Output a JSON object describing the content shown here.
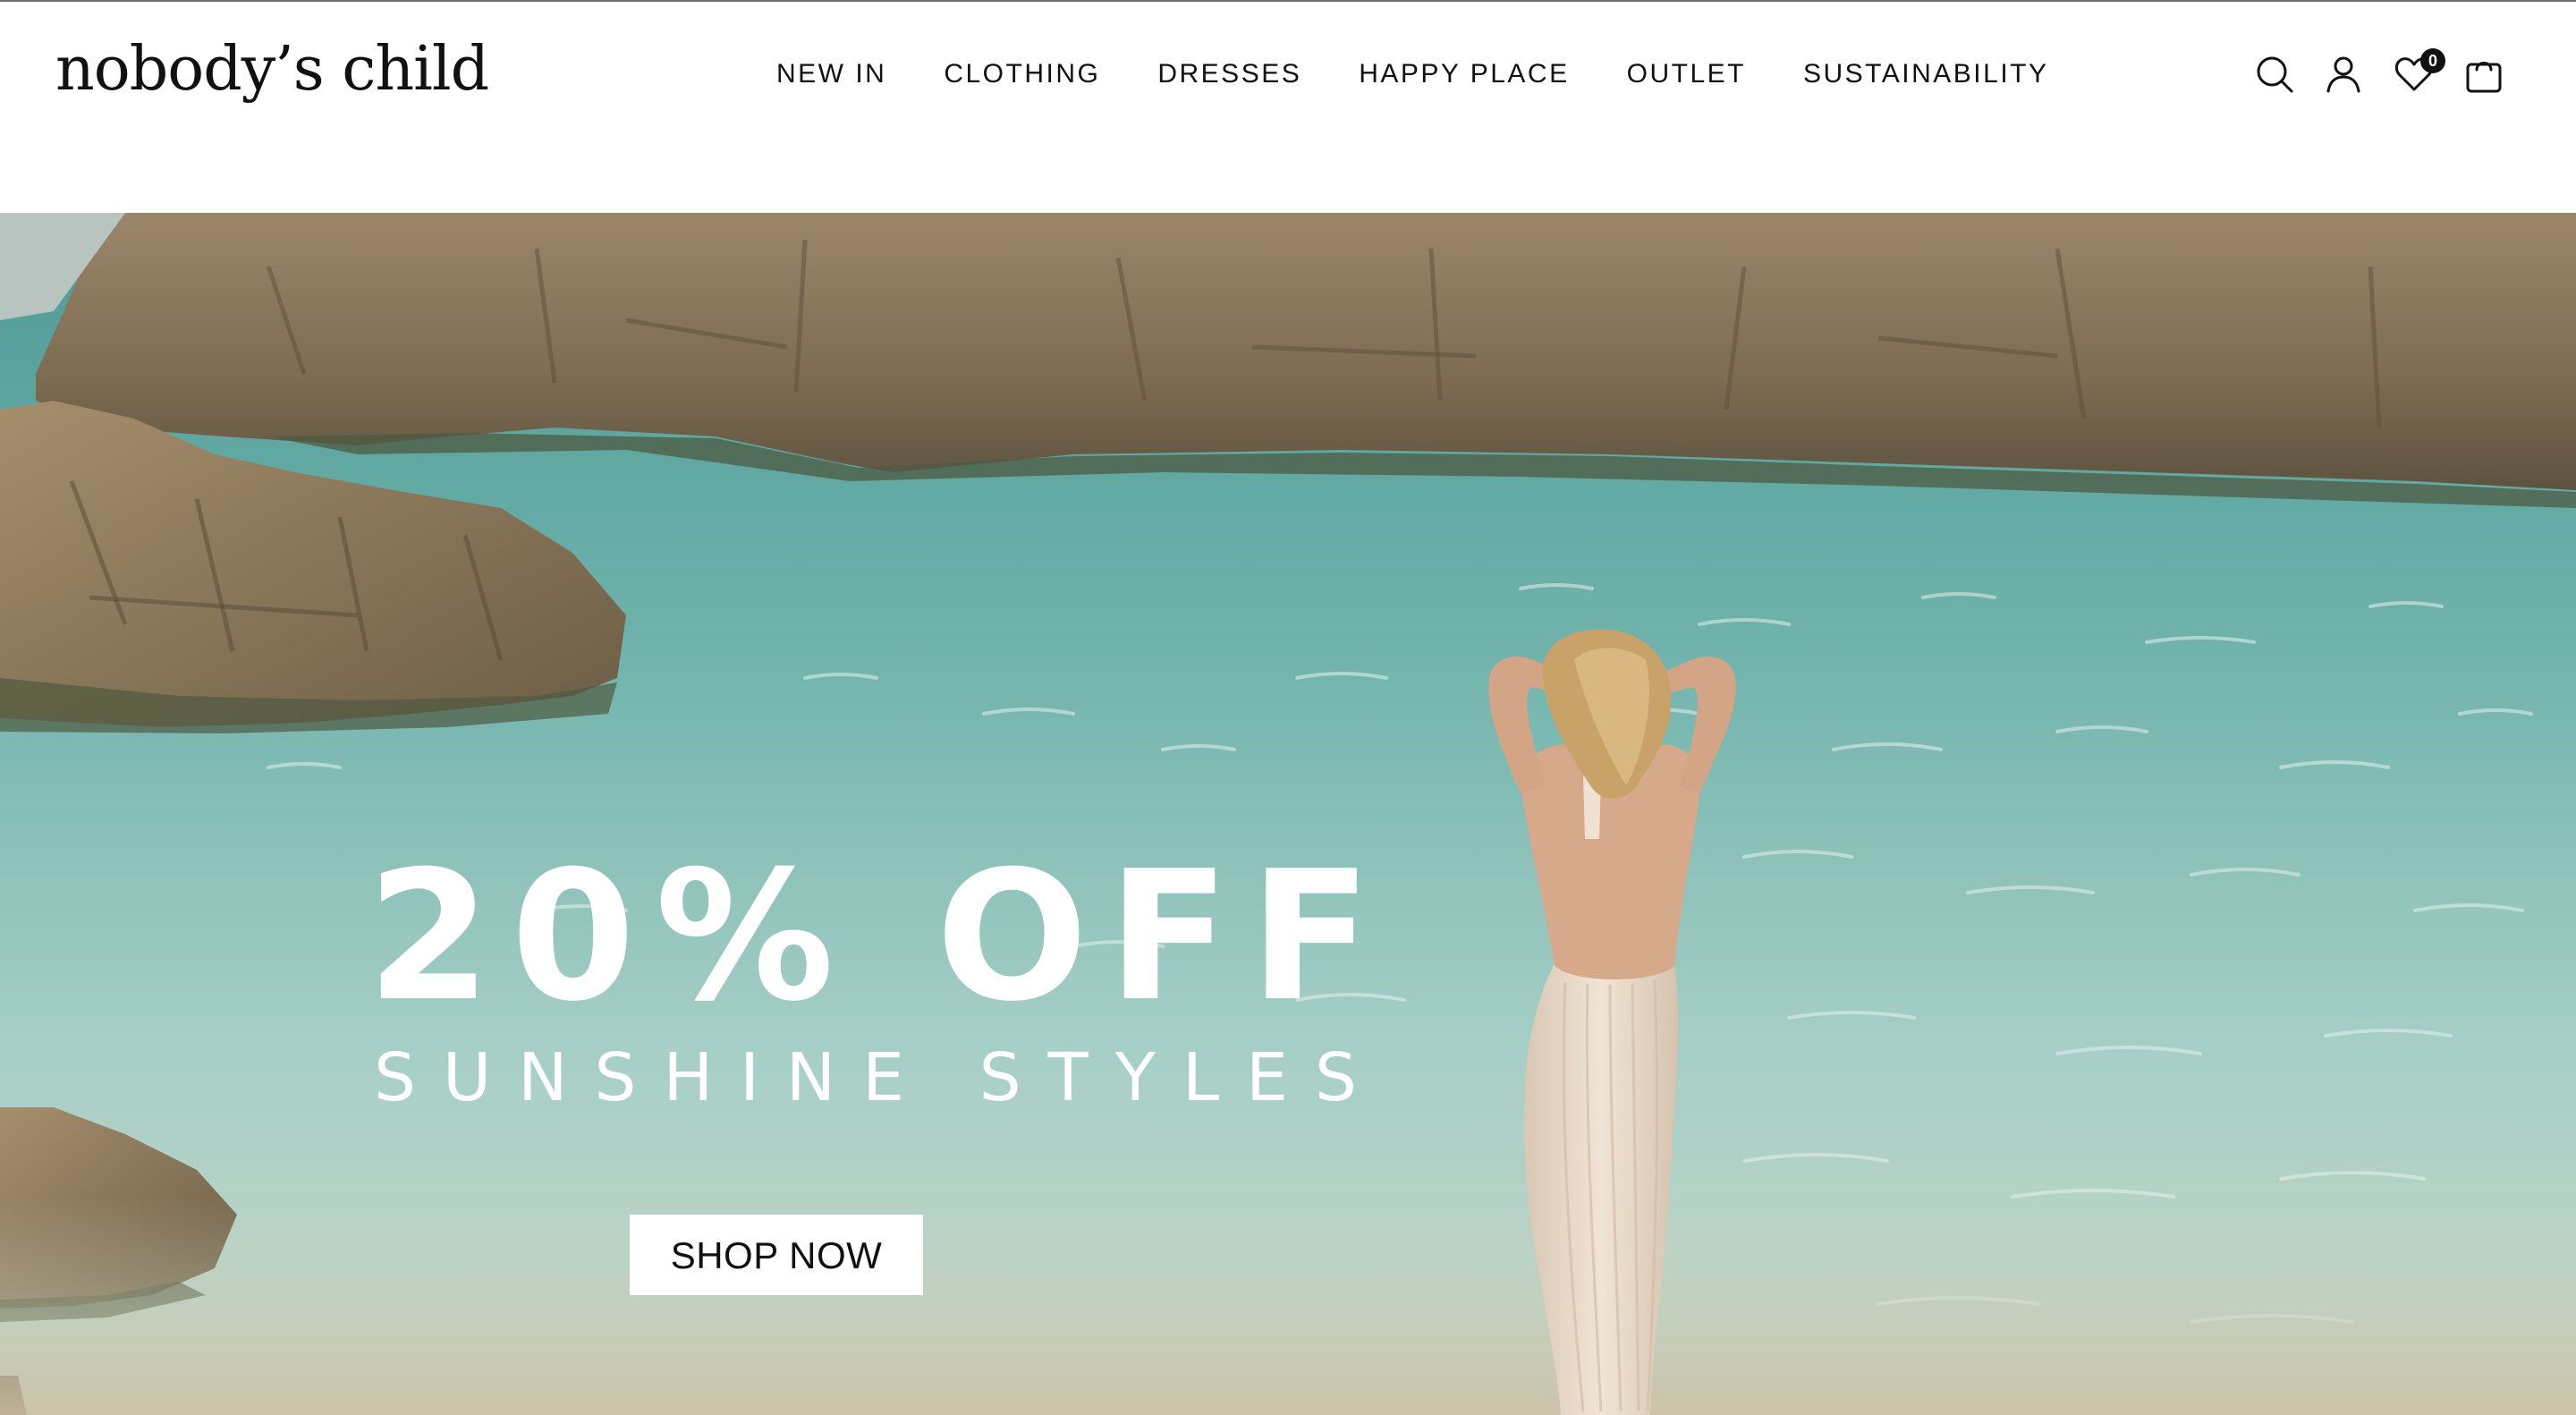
{
  "brand": {
    "logo_text": "nobody’s child"
  },
  "nav": {
    "items": [
      {
        "label": "NEW IN"
      },
      {
        "label": "CLOTHING"
      },
      {
        "label": "DRESSES"
      },
      {
        "label": "HAPPY PLACE"
      },
      {
        "label": "OUTLET"
      },
      {
        "label": "SUSTAINABILITY"
      }
    ]
  },
  "header_icons": {
    "search": "search-icon",
    "account": "user-icon",
    "wishlist": "heart-icon",
    "wishlist_count": "0",
    "cart": "bag-icon"
  },
  "hero": {
    "headline": "20% OFF",
    "subheadline": "SUNSHINE STYLES",
    "cta_label": "SHOP NOW"
  },
  "colors": {
    "text": "#111111",
    "background": "#ffffff",
    "water": "#5fa7a1",
    "rock": "#8c7a60",
    "dress": "#ecdccb"
  }
}
